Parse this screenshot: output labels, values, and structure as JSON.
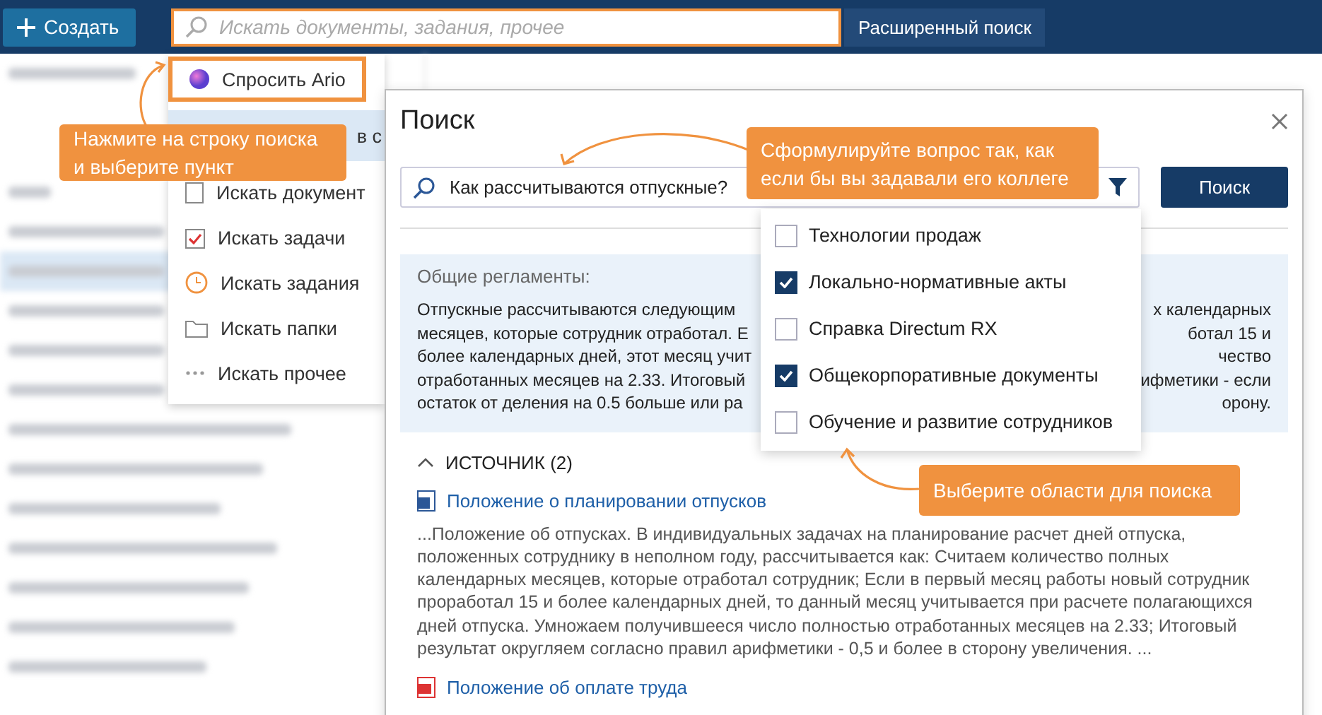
{
  "topbar": {
    "create_button": "Создать",
    "search": {
      "placeholder": "Искать документы, задания, прочее",
      "focused": true
    },
    "advanced_button": "Расширенный поиск"
  },
  "search_menu": {
    "items": [
      {
        "kind": "ario",
        "label": "Спросить Ario",
        "outlined": true,
        "selected": false
      },
      {
        "kind": "recent",
        "label": "в с",
        "outlined": false,
        "selected": true
      },
      {
        "kind": "documents",
        "label": "Искать документ",
        "outlined": false,
        "selected": false
      },
      {
        "kind": "tasks",
        "label": "Искать задачи",
        "outlined": false,
        "selected": false
      },
      {
        "kind": "assignments",
        "label": "Искать задания",
        "outlined": false,
        "selected": false
      },
      {
        "kind": "folders",
        "label": "Искать папки",
        "outlined": false,
        "selected": false
      },
      {
        "kind": "other",
        "label": "Искать прочее",
        "outlined": false,
        "selected": false
      }
    ]
  },
  "dialog": {
    "title": "Поиск",
    "query": "Как рассчитываются отпускные?",
    "search_button": "Поиск",
    "filter_options": [
      {
        "label": "Технологии продаж",
        "checked": false
      },
      {
        "label": "Локально-нормативные акты",
        "checked": true
      },
      {
        "label": "Справка Directum RX",
        "checked": false
      },
      {
        "label": "Общекорпоративные документы",
        "checked": true
      },
      {
        "label": "Обучение и развитие сотрудников",
        "checked": false
      }
    ],
    "answer": {
      "heading": "Общие регламенты:",
      "lines": [
        {
          "left": "Отпускные рассчитываются следующим",
          "right": "х календарных"
        },
        {
          "left": "месяцев, которые сотрудник отработал. Е",
          "right": "ботал 15 и"
        },
        {
          "left": "более календарных дней, этот месяц учит",
          "right": "чество"
        },
        {
          "left": "отработанных месяцев на 2.33. Итоговый",
          "right": "ифметики - если"
        },
        {
          "left": "остаток от деления на 0.5 больше или ра",
          "right": "орону."
        }
      ]
    },
    "sources": {
      "heading": "ИСТОЧНИК (2)",
      "expanded": true,
      "items": [
        {
          "kind": "word",
          "title": "Положение о планировании отпусков",
          "snippet": "...Положение об отпусках. В индивидуальных задачах на планирование расчет дней отпуска, положенных сотруднику в неполном году, рассчитывается как: Считаем количество полных календарных месяцев, которые отработал сотрудник; Если в первый месяц работы новый сотрудник проработал 15 и более календарных дней, то данный месяц учитывается при расчете полагающихся дней отпуска. Умножаем получившееся число полностью отработанных месяцев на 2.33; Итоговый результат округляем согласно правил арифметики - 0,5 и более в сторону увеличения. ..."
        },
        {
          "kind": "pdf",
          "title": "Положение об оплате труда"
        }
      ]
    }
  },
  "callouts": [
    {
      "text": "Нажмите на строку поиска и выберите пункт"
    },
    {
      "text": "Сформулируйте вопрос так, как если бы вы задавали его коллеге"
    },
    {
      "text": "Выберите области для поиска"
    }
  ]
}
